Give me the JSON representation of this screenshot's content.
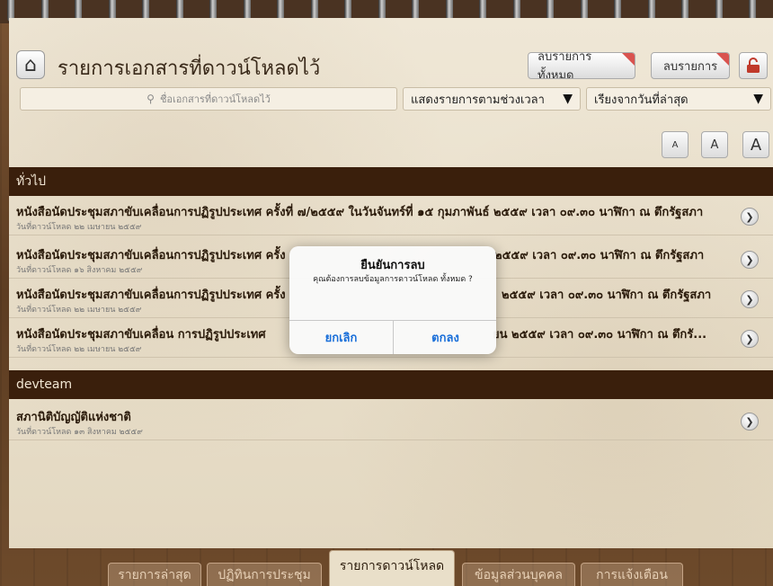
{
  "header": {
    "title": "รายการเอกสารที่ดาวน์โหลดไว้",
    "delete_all_label": "ลบรายการทั้งหมด",
    "delete_label": "ลบรายการ"
  },
  "search": {
    "placeholder": "ชื่อเอกสารที่ดาวน์โหลดไว้"
  },
  "filters": {
    "time_range": "แสดงรายการตามช่วงเวลา",
    "sort": "เรียงจากวันที่ล่าสุด"
  },
  "font_sizes": [
    "A",
    "A",
    "A"
  ],
  "sections": [
    {
      "name": "ทั่วไป",
      "items": [
        {
          "title": "หนังสือนัดประชุมสภาขับเคลื่อนการปฏิรูปประเทศ ครั้งที่ ๗/๒๕๕๙ ในวันจันทร์ที่ ๑๕ กุมภาพันธ์ ๒๕๕๙ เวลา ๐๙.๓๐ นาฬิกา ณ ตึกรัฐสภา",
          "date": "วันที่ดาวน์โหลด ๒๒ เมษายน ๒๕๕๙"
        },
        {
          "title": "หนังสือนัดประชุมสภาขับเคลื่อนการปฏิรูปประเทศ ครั้ง",
          "title_tail": "๒๕๕๙ เวลา ๐๙.๓๐ นาฬิกา ณ ตึกรัฐสภา",
          "date": "วันที่ดาวน์โหลด ๑๖ สิงหาคม ๒๕๕๙"
        },
        {
          "title": "หนังสือนัดประชุมสภาขับเคลื่อนการปฏิรูปประเทศ ครั้ง",
          "title_tail": "๒๕๕๙ เวลา ๐๙.๓๐ นาฬิกา ณ ตึกรัฐสภา",
          "date": "วันที่ดาวน์โหลด ๒๒ เมษายน ๒๕๕๙"
        },
        {
          "title": "หนังสือนัดประชุมสภาขับเคลื่อน   การปฏิรูปประเทศ",
          "title_tail": "ยน ๒๕๕๙ เวลา ๐๙.๓๐ นาฬิกา      ณ ตึกรั...",
          "date": "วันที่ดาวน์โหลด ๒๒ เมษายน ๒๕๕๙"
        }
      ]
    },
    {
      "name": "devteam",
      "items": [
        {
          "title": "สภานิติบัญญัติแห่งชาติ",
          "date": "วันที่ดาวน์โหลด ๑๓ สิงหาคม ๒๕๕๙"
        }
      ]
    }
  ],
  "dialog": {
    "title": "ยืนยันการลบ",
    "message": "คุณต้องการลบข้อมูลการดาวน์โหลด ทั้งหมด ?",
    "cancel": "ยกเลิก",
    "ok": "ตกลง"
  },
  "tabs": [
    {
      "label": "รายการล่าสุด"
    },
    {
      "label": "ปฏิทินการประชุม"
    },
    {
      "label": "รายการดาวน์โหลด"
    },
    {
      "label": "ข้อมูลส่วนบุคคล"
    },
    {
      "label": "การแจ้งเตือน"
    }
  ],
  "icons": {
    "home": "home-icon",
    "lock": "lock-icon",
    "search": "search-icon",
    "dropdown": "dropdown-triangle-icon",
    "chevron": "chevron-right-icon"
  },
  "colors": {
    "section_bar": "#3a1f0c",
    "dialog_button": "#1a6fd9",
    "delete_corner": "#d9534f"
  }
}
